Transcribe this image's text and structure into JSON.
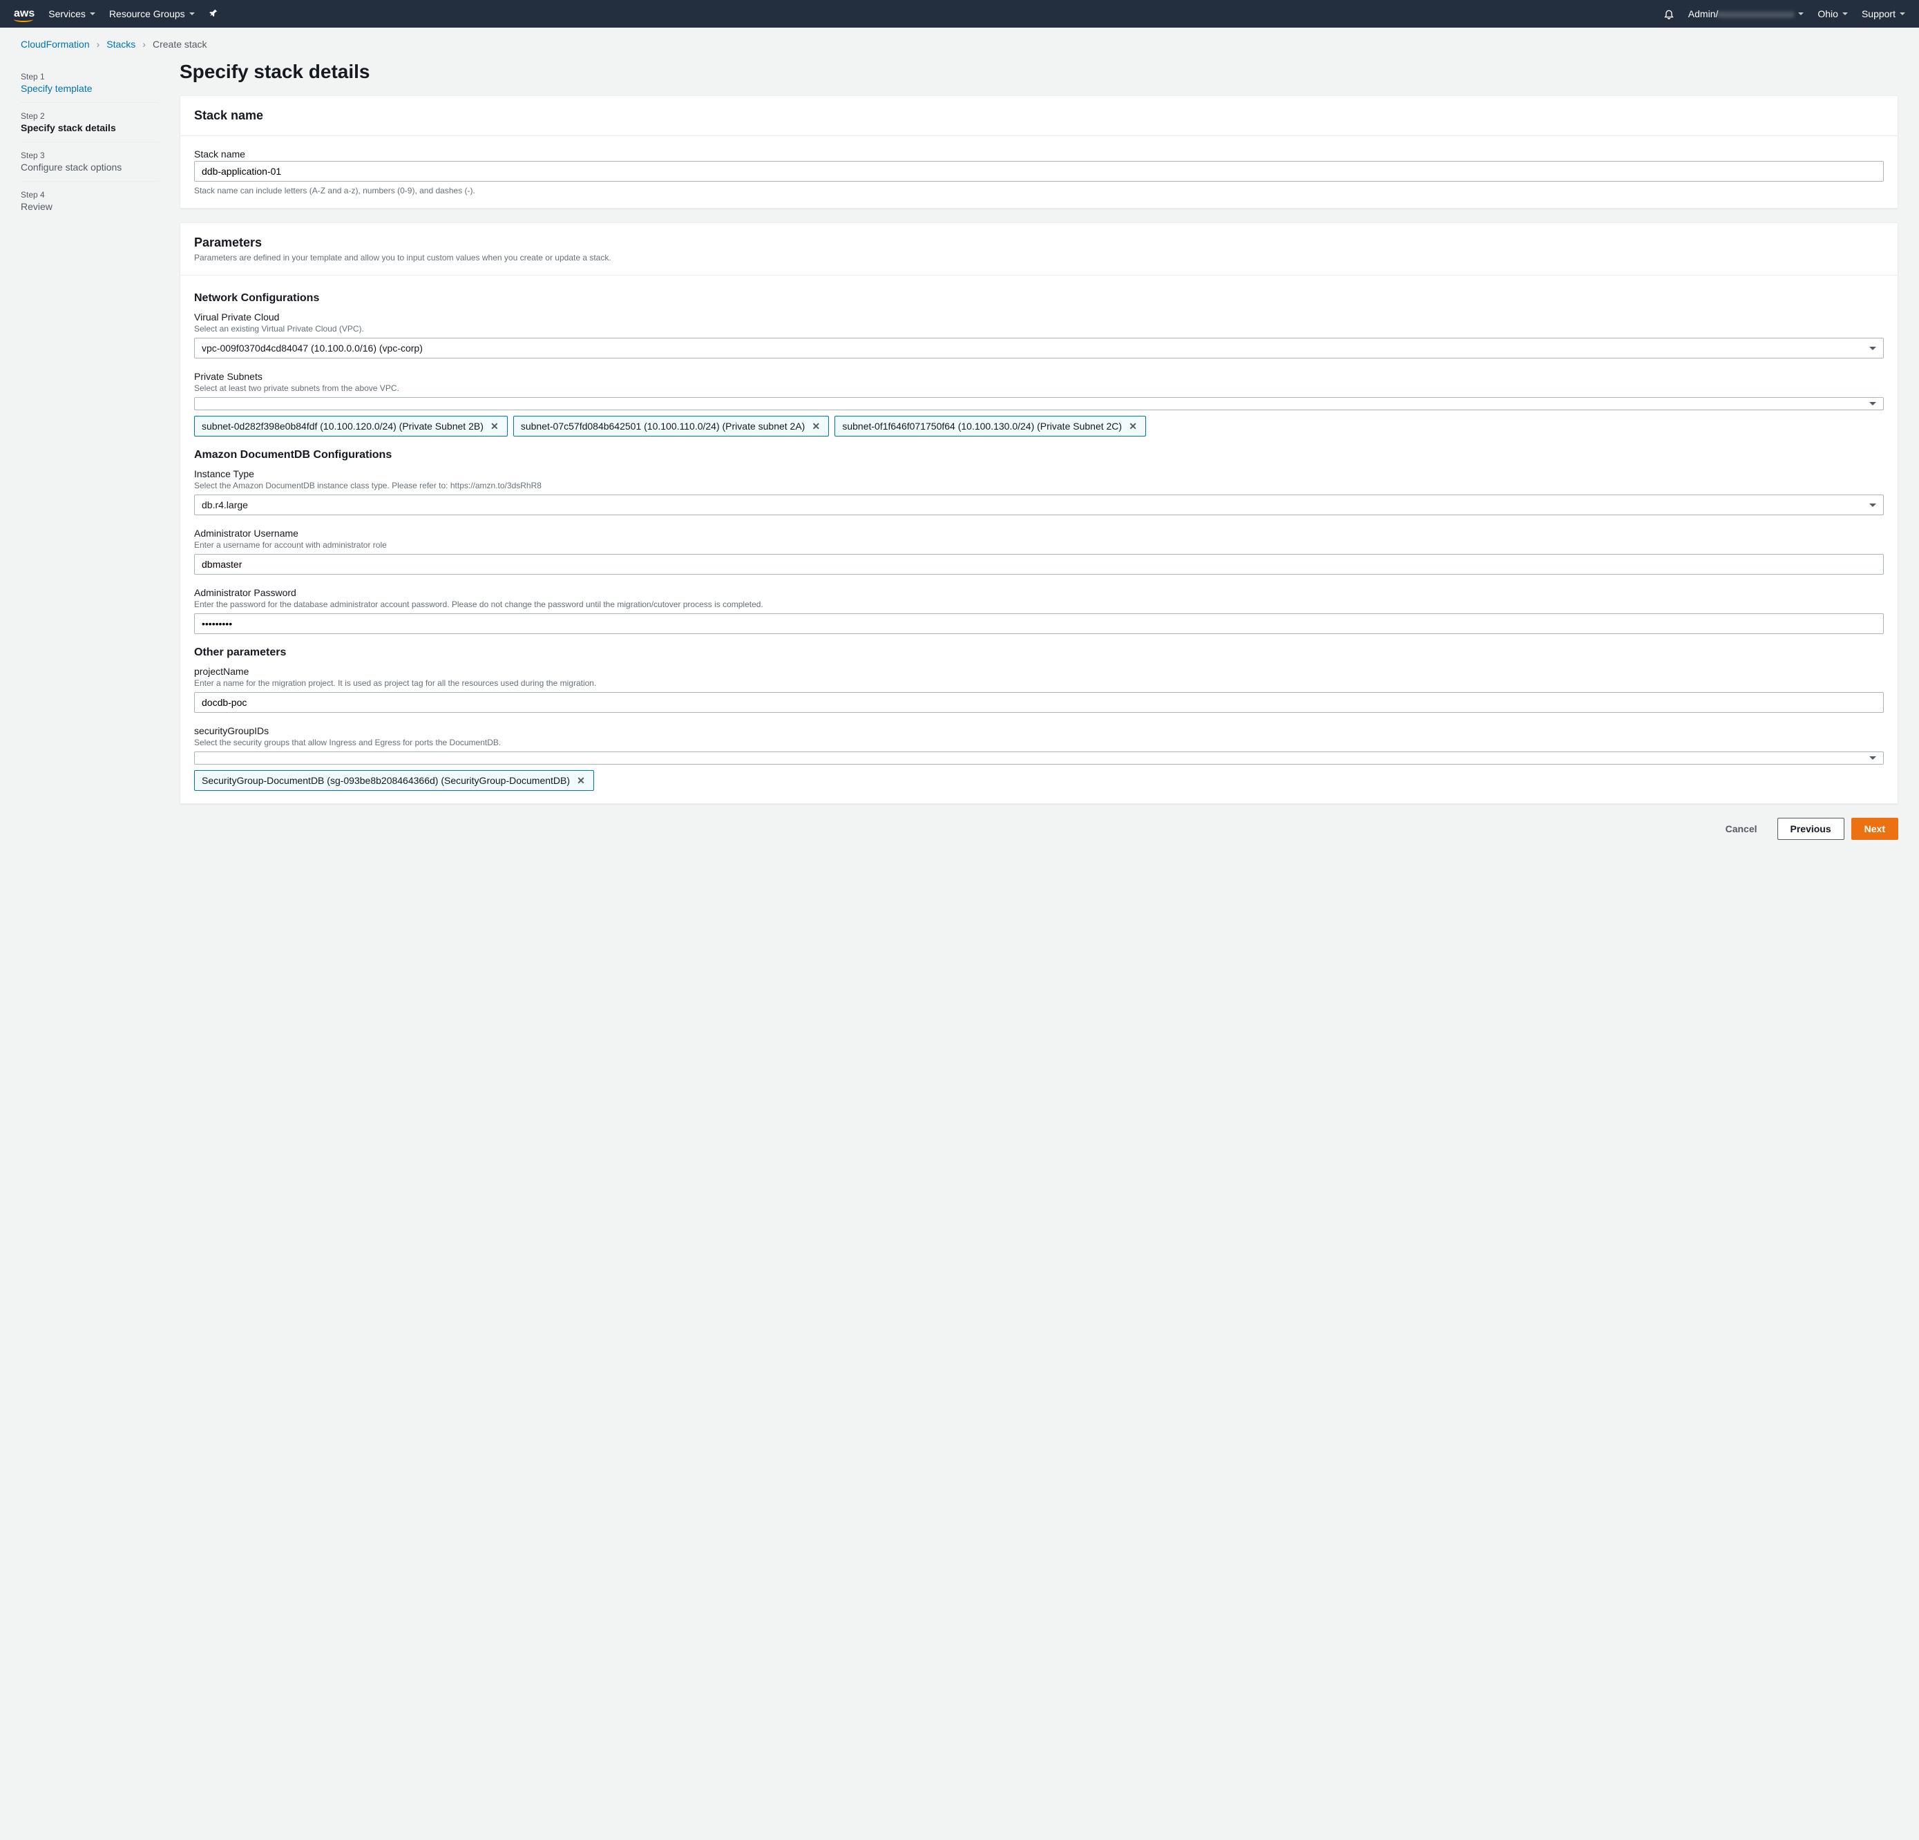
{
  "topbar": {
    "logo": "aws",
    "services": "Services",
    "resource_groups": "Resource Groups",
    "user_prefix": "Admin/",
    "user_blur": "xxxxxxxxxxxxxxxx",
    "region": "Ohio",
    "support": "Support"
  },
  "breadcrumbs": {
    "cloudformation": "CloudFormation",
    "stacks": "Stacks",
    "create": "Create stack"
  },
  "steps": [
    {
      "num": "Step 1",
      "title": "Specify template",
      "state": "link"
    },
    {
      "num": "Step 2",
      "title": "Specify stack details",
      "state": "active"
    },
    {
      "num": "Step 3",
      "title": "Configure stack options",
      "state": ""
    },
    {
      "num": "Step 4",
      "title": "Review",
      "state": ""
    }
  ],
  "page_title": "Specify stack details",
  "stack_panel": {
    "header": "Stack name",
    "label": "Stack name",
    "value": "ddb-application-01",
    "hint": "Stack name can include letters (A-Z and a-z), numbers (0-9), and dashes (-)."
  },
  "params_panel": {
    "header": "Parameters",
    "desc": "Parameters are defined in your template and allow you to input custom values when you create or update a stack."
  },
  "network": {
    "heading": "Network Configurations",
    "vpc_label": "Virual Private Cloud",
    "vpc_hint": "Select an existing Virtual Private Cloud (VPC).",
    "vpc_value": "vpc-009f0370d4cd84047 (10.100.0.0/16) (vpc-corp)",
    "subnets_label": "Private Subnets",
    "subnets_hint": "Select at least two private subnets from the above VPC.",
    "subnets_chips": [
      "subnet-0d282f398e0b84fdf (10.100.120.0/24) (Private Subnet 2B)",
      "subnet-07c57fd084b642501 (10.100.110.0/24) (Private subnet 2A)",
      "subnet-0f1f646f071750f64 (10.100.130.0/24) (Private Subnet 2C)"
    ]
  },
  "docdb": {
    "heading": "Amazon DocumentDB Configurations",
    "instance_label": "Instance Type",
    "instance_hint": "Select the Amazon DocumentDB instance class type. Please refer to: https://amzn.to/3dsRhR8",
    "instance_value": "db.r4.large",
    "admin_user_label": "Administrator Username",
    "admin_user_hint": "Enter a username for account with administrator role",
    "admin_user_value": "dbmaster",
    "admin_pass_label": "Administrator Password",
    "admin_pass_hint": "Enter the password for the database administrator account password. Please do not change the password until the migration/cutover process is completed.",
    "admin_pass_value": "•••••••••"
  },
  "other": {
    "heading": "Other parameters",
    "project_label": "projectName",
    "project_hint": "Enter a name for the migration project. It is used as project tag for all the resources used during the migration.",
    "project_value": "docdb-poc",
    "sg_label": "securityGroupIDs",
    "sg_hint": "Select the security groups that allow Ingress and Egress for ports the DocumentDB.",
    "sg_chips": [
      "SecurityGroup-DocumentDB (sg-093be8b208464366d) (SecurityGroup-DocumentDB)"
    ]
  },
  "buttons": {
    "cancel": "Cancel",
    "previous": "Previous",
    "next": "Next"
  }
}
